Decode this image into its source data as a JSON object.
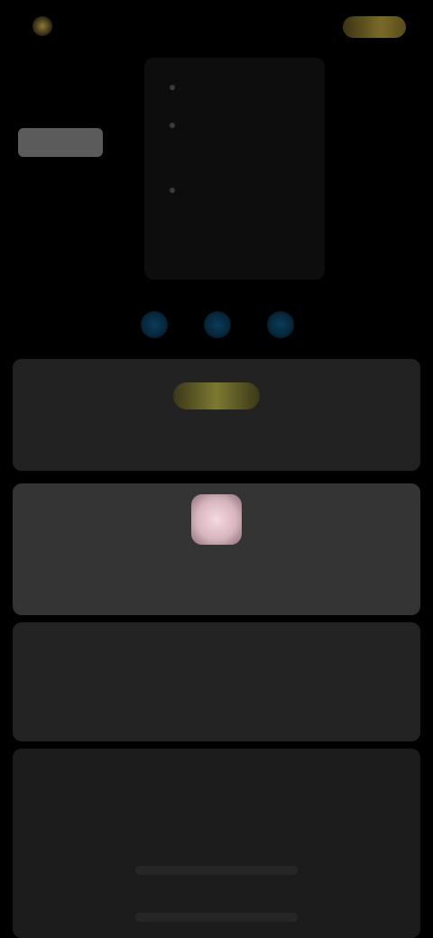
{
  "header": {
    "brand": "",
    "left_link": "",
    "right_link": "",
    "connect_label": "",
    "side_tag": ""
  },
  "menu": {
    "items": [
      "",
      "",
      ""
    ],
    "sub_label": ""
  },
  "social": [
    "",
    "",
    ""
  ],
  "cards": {
    "card1": {
      "badge": "",
      "caption": ""
    },
    "card2": {
      "caption": ""
    },
    "card3": {
      "title": "",
      "side": "",
      "right": ""
    },
    "card4": {
      "title": ""
    }
  },
  "colors": {
    "background": "#000000",
    "accent": "#7d7a33",
    "social": "#2f7fb4",
    "card": "#222222"
  }
}
